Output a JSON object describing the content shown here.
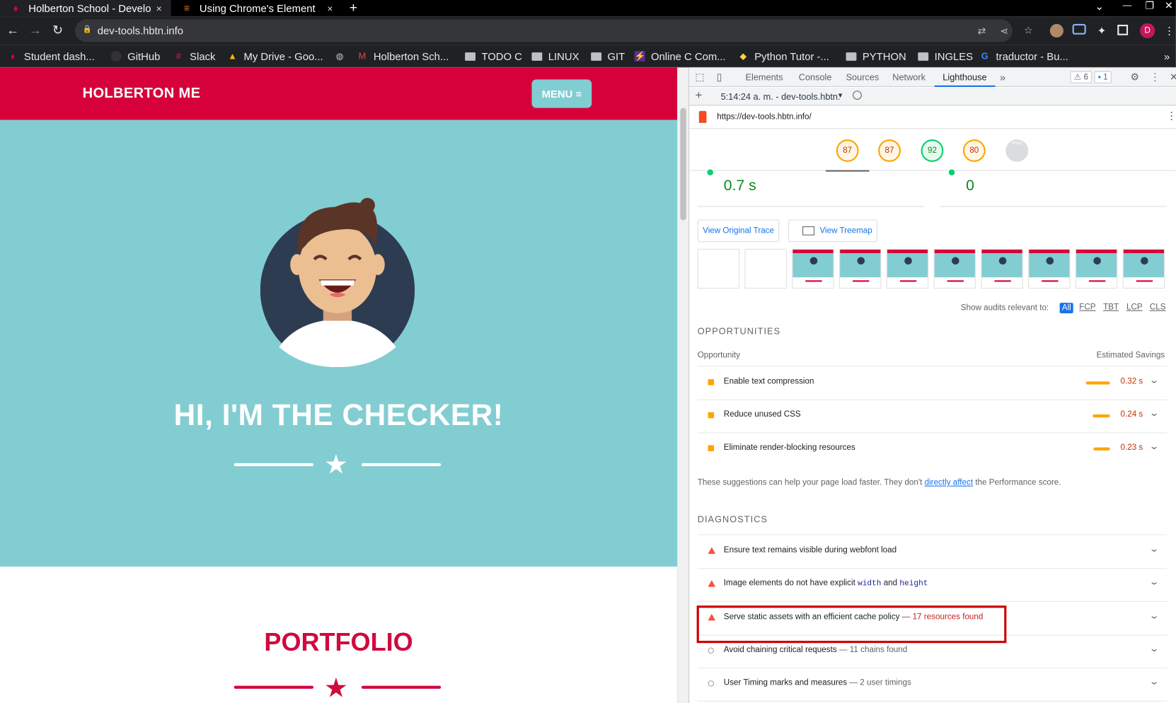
{
  "tabs": [
    {
      "title": "Holberton School - Develo",
      "close": "×"
    },
    {
      "title": "Using Chrome's Element",
      "close": "×"
    }
  ],
  "new_tab": "+",
  "window_controls": {
    "chevron": "⌄",
    "minimize": "—",
    "restore": "❐",
    "close": "✕"
  },
  "toolbar": {
    "url": "dev-tools.hbtn.info",
    "profile_initial": "D"
  },
  "bookmarks": [
    "Student dash...",
    "GitHub",
    "Slack",
    "My Drive - Goo...",
    "",
    "Holberton Sch...",
    "TODO C",
    "LINUX",
    "GIT",
    "Online C Com...",
    "Python Tutor -...",
    "PYTHON",
    "INGLES",
    "traductor - Bu..."
  ],
  "bookmarks_more": "»",
  "site": {
    "brand": "HOLBERTON ME",
    "menu": "MENU ≡",
    "hero_title": "HI, I'M THE CHECKER!",
    "portfolio": "PORTFOLIO"
  },
  "devtools": {
    "tabs": [
      "Elements",
      "Console",
      "Sources",
      "Network",
      "Lighthouse"
    ],
    "more_tabs": "»",
    "warnings": "⚠ 6",
    "messages": "1",
    "report_selector": "5:14:24 a. m. - dev-tools.hbtn.",
    "report_url": "https://dev-tools.hbtn.info/",
    "scores": [
      "87",
      "87",
      "92",
      "80",
      "PWA"
    ],
    "metrics": [
      "0.7 s",
      "0"
    ],
    "buttons": {
      "view_trace": "View Original Trace",
      "view_treemap": "View Treemap"
    },
    "show_audits": "Show audits relevant to:",
    "filters": [
      "All",
      "FCP",
      "TBT",
      "LCP",
      "CLS"
    ],
    "opportunities": {
      "heading": "OPPORTUNITIES",
      "col_left": "Opportunity",
      "col_right": "Estimated Savings",
      "items": [
        {
          "title": "Enable text compression",
          "savings": "0.32 s"
        },
        {
          "title": "Reduce unused CSS",
          "savings": "0.24 s"
        },
        {
          "title": "Eliminate render-blocking resources",
          "savings": "0.23 s"
        }
      ],
      "note_before": "These suggestions can help your page load faster. They don't ",
      "note_link": "directly affect",
      "note_after": " the Performance score."
    },
    "diagnostics": {
      "heading": "DIAGNOSTICS",
      "d1": "Ensure text remains visible during webfont load",
      "d2_a": "Image elements do not have explicit ",
      "d2_code1": "width",
      "d2_b": " and ",
      "d2_code2": "height",
      "d3": "Serve static assets with an efficient cache policy",
      "d3_sub": " — 17 resources found",
      "d4": "Avoid chaining critical requests",
      "d4_sub": " — 11 chains found",
      "d5": "User Timing marks and measures",
      "d5_sub": " — 2 user timings"
    }
  },
  "colors": {
    "brand_red": "#d6003b",
    "hero_teal": "#82cdd2",
    "score_orange": "#ffa400",
    "score_green": "#0cce6b",
    "fail_red": "#ff4e42"
  }
}
